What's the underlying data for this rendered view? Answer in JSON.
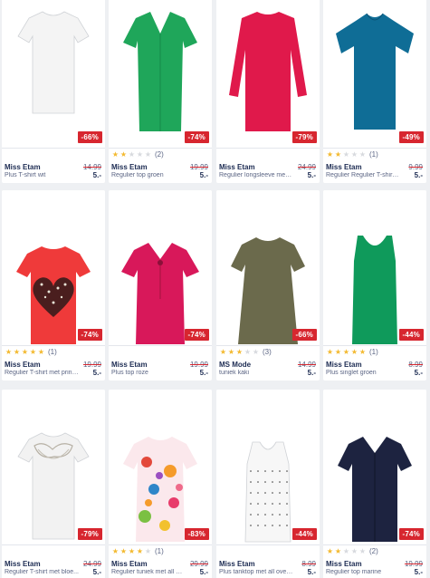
{
  "products": [
    {
      "brand": "Miss Etam",
      "desc": "Plus T-shirt wit",
      "old_price": "14.99",
      "price": "5.-",
      "discount": "-66%",
      "rating": 0,
      "reviews": "",
      "color": "#f4f4f4",
      "shape": "tee-short"
    },
    {
      "brand": "Miss Etam",
      "desc": "Regulier top groen",
      "old_price": "19.99",
      "price": "5.-",
      "discount": "-74%",
      "rating": 2,
      "reviews": "(2)",
      "color": "#1fa65a",
      "shape": "vneck"
    },
    {
      "brand": "Miss Etam",
      "desc": "Regulier longsleeve met l...",
      "old_price": "24.99",
      "price": "5.-",
      "discount": "-79%",
      "rating": 0,
      "reviews": "",
      "color": "#e0194b",
      "shape": "longsleeve"
    },
    {
      "brand": "Miss Etam",
      "desc": "Regulier Regulier T-shirt bl...",
      "old_price": "9.99",
      "price": "5.-",
      "discount": "-49%",
      "rating": 2,
      "reviews": "(1)",
      "color": "#0f6d96",
      "shape": "flutter"
    },
    {
      "brand": "Miss Etam",
      "desc": "Regulier T-shirt met print r...",
      "old_price": "19.99",
      "price": "5.-",
      "discount": "-74%",
      "rating": 5,
      "reviews": "(1)",
      "color": "#ef3a3a",
      "shape": "heart"
    },
    {
      "brand": "Miss Etam",
      "desc": "Plus top roze",
      "old_price": "19.99",
      "price": "5.-",
      "discount": "-74%",
      "rating": 0,
      "reviews": "",
      "color": "#d8185a",
      "shape": "blouse"
    },
    {
      "brand": "MS Mode",
      "desc": "tuniek kaki",
      "old_price": "14.99",
      "price": "5.-",
      "discount": "-66%",
      "rating": 3,
      "reviews": "(3)",
      "color": "#6b6a4c",
      "shape": "tunic"
    },
    {
      "brand": "Miss Etam",
      "desc": "Plus singlet groen",
      "old_price": "8.99",
      "price": "5.-",
      "discount": "-44%",
      "rating": 5,
      "reviews": "(1)",
      "color": "#0f9a5b",
      "shape": "tank"
    },
    {
      "brand": "Miss Etam",
      "desc": "Regulier T-shirt met bloe...",
      "old_price": "24.99",
      "price": "5.-",
      "discount": "-79%",
      "rating": 0,
      "reviews": "",
      "color": "#f2f2f2",
      "shape": "lace"
    },
    {
      "brand": "Miss Etam",
      "desc": "Regulier tuniek met all ov...",
      "old_price": "29.99",
      "price": "5.-",
      "discount": "-83%",
      "rating": 4,
      "reviews": "(1)",
      "color": "#f5a3b8",
      "shape": "floral"
    },
    {
      "brand": "Miss Etam",
      "desc": "Plus tanktop met all over p...",
      "old_price": "8.99",
      "price": "5.-",
      "discount": "-44%",
      "rating": 0,
      "reviews": "",
      "color": "#f7f7f7",
      "shape": "dotted"
    },
    {
      "brand": "Miss Etam",
      "desc": "Regulier top marine",
      "old_price": "19.99",
      "price": "5.-",
      "discount": "-74%",
      "rating": 2,
      "reviews": "(2)",
      "color": "#1d2340",
      "shape": "navy"
    }
  ],
  "colors": {
    "discount": "#d7262f",
    "star": "#f3b92f",
    "star_empty": "#d7d9de",
    "text": "#1c2b52"
  }
}
